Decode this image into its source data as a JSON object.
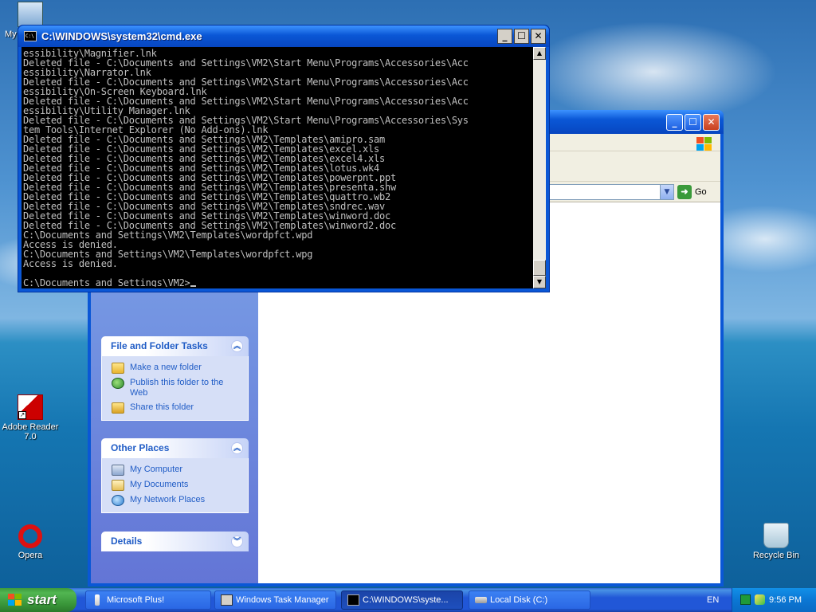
{
  "desktop": {
    "icons": [
      {
        "label": "My",
        "icon": "my-computer-icon"
      },
      {
        "label": "Adobe Reader 7.0",
        "icon": "adobe-reader-icon"
      },
      {
        "label": "Opera",
        "icon": "opera-icon"
      },
      {
        "label": "Recycle Bin",
        "icon": "recycle-bin-icon"
      }
    ]
  },
  "cmd": {
    "title": "C:\\WINDOWS\\system32\\cmd.exe",
    "lines": [
      "essibility\\Magnifier.lnk",
      "Deleted file - C:\\Documents and Settings\\VM2\\Start Menu\\Programs\\Accessories\\Acc",
      "essibility\\Narrator.lnk",
      "Deleted file - C:\\Documents and Settings\\VM2\\Start Menu\\Programs\\Accessories\\Acc",
      "essibility\\On-Screen Keyboard.lnk",
      "Deleted file - C:\\Documents and Settings\\VM2\\Start Menu\\Programs\\Accessories\\Acc",
      "essibility\\Utility Manager.lnk",
      "Deleted file - C:\\Documents and Settings\\VM2\\Start Menu\\Programs\\Accessories\\Sys",
      "tem Tools\\Internet Explorer (No Add-ons).lnk",
      "Deleted file - C:\\Documents and Settings\\VM2\\Templates\\amipro.sam",
      "Deleted file - C:\\Documents and Settings\\VM2\\Templates\\excel.xls",
      "Deleted file - C:\\Documents and Settings\\VM2\\Templates\\excel4.xls",
      "Deleted file - C:\\Documents and Settings\\VM2\\Templates\\lotus.wk4",
      "Deleted file - C:\\Documents and Settings\\VM2\\Templates\\powerpnt.ppt",
      "Deleted file - C:\\Documents and Settings\\VM2\\Templates\\presenta.shw",
      "Deleted file - C:\\Documents and Settings\\VM2\\Templates\\quattro.wb2",
      "Deleted file - C:\\Documents and Settings\\VM2\\Templates\\sndrec.wav",
      "Deleted file - C:\\Documents and Settings\\VM2\\Templates\\winword.doc",
      "Deleted file - C:\\Documents and Settings\\VM2\\Templates\\winword2.doc",
      "C:\\Documents and Settings\\VM2\\Templates\\wordpfct.wpd",
      "Access is denied.",
      "C:\\Documents and Settings\\VM2\\Templates\\wordpfct.wpg",
      "Access is denied.",
      ""
    ],
    "prompt": "C:\\Documents and Settings\\VM2>"
  },
  "explorer": {
    "go_label": "Go",
    "file_folder_tasks": {
      "title": "File and Folder Tasks",
      "items": [
        "Make a new folder",
        "Publish this folder to the Web",
        "Share this folder"
      ]
    },
    "other_places": {
      "title": "Other Places",
      "items": [
        "My Computer",
        "My Documents",
        "My Network Places"
      ]
    },
    "details": {
      "title": "Details"
    }
  },
  "taskbar": {
    "start_label": "start",
    "buttons": [
      {
        "label": "Microsoft Plus!",
        "active": false
      },
      {
        "label": "Windows Task Manager",
        "active": false
      },
      {
        "label": "C:\\WINDOWS\\syste...",
        "active": true
      },
      {
        "label": "Local Disk (C:)",
        "active": false
      }
    ],
    "language": "EN",
    "clock": "9:56 PM"
  },
  "colors": {
    "titlebar_blue": "#0a57d6",
    "task_link": "#215dc6",
    "start_green": "#3c9a3c",
    "console_text": "#c0c0c0"
  }
}
